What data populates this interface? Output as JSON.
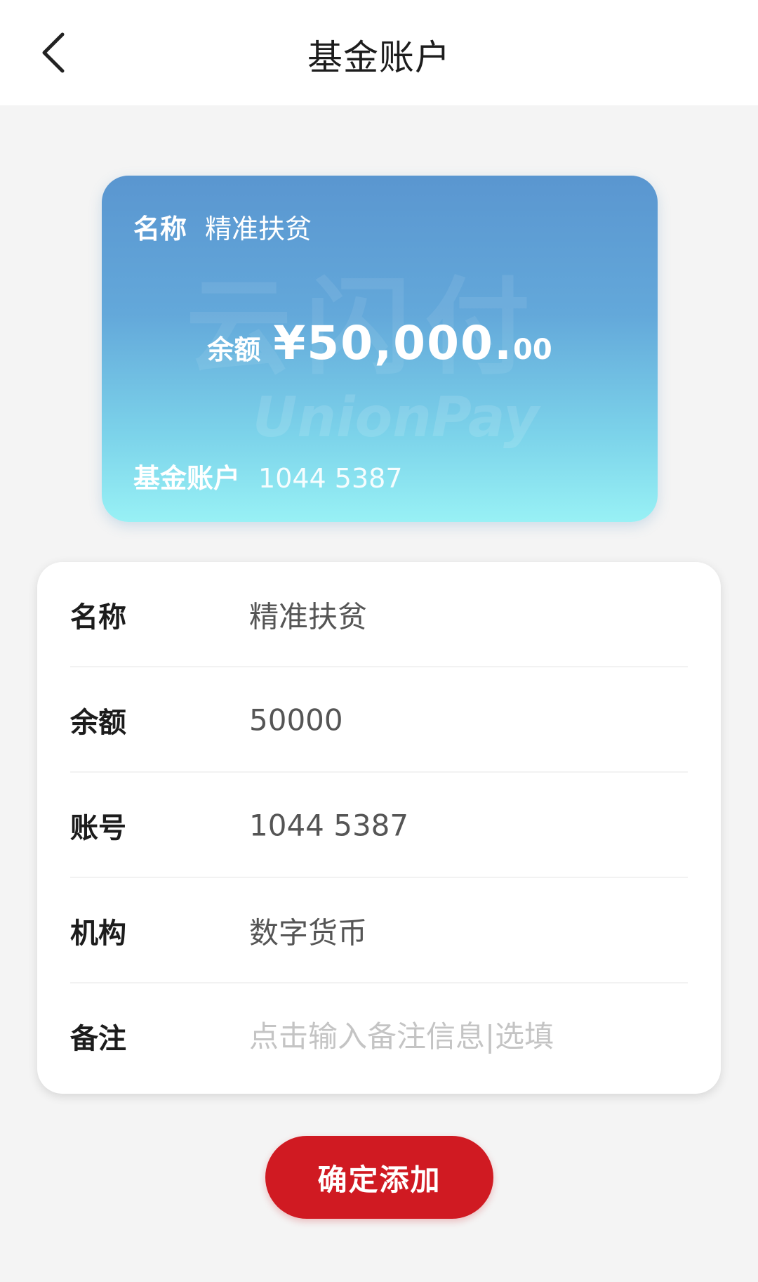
{
  "header": {
    "title": "基金账户",
    "back_icon": "chevron-left-icon"
  },
  "card": {
    "name_label": "名称",
    "name_value": "精准扶贫",
    "balance_label": "余额",
    "balance_amount": "¥50,000.",
    "balance_cents": "00",
    "account_label": "基金账户",
    "account_number": "1044 5387",
    "watermark_cn": "云闪付",
    "watermark_en": "UnionPay"
  },
  "details": {
    "rows": [
      {
        "label": "名称",
        "value": "精准扶贫"
      },
      {
        "label": "余额",
        "value": "50000"
      },
      {
        "label": "账号",
        "value": "1044 5387"
      },
      {
        "label": "机构",
        "value": "数字货币"
      }
    ],
    "remark": {
      "label": "备注",
      "placeholder": "点击输入备注信息|选填"
    }
  },
  "actions": {
    "confirm_label": "确定添加"
  },
  "colors": {
    "accent": "#d01a22",
    "background": "#f4f4f4",
    "card_top": "#5a96d0",
    "card_bottom": "#98f1f5"
  }
}
